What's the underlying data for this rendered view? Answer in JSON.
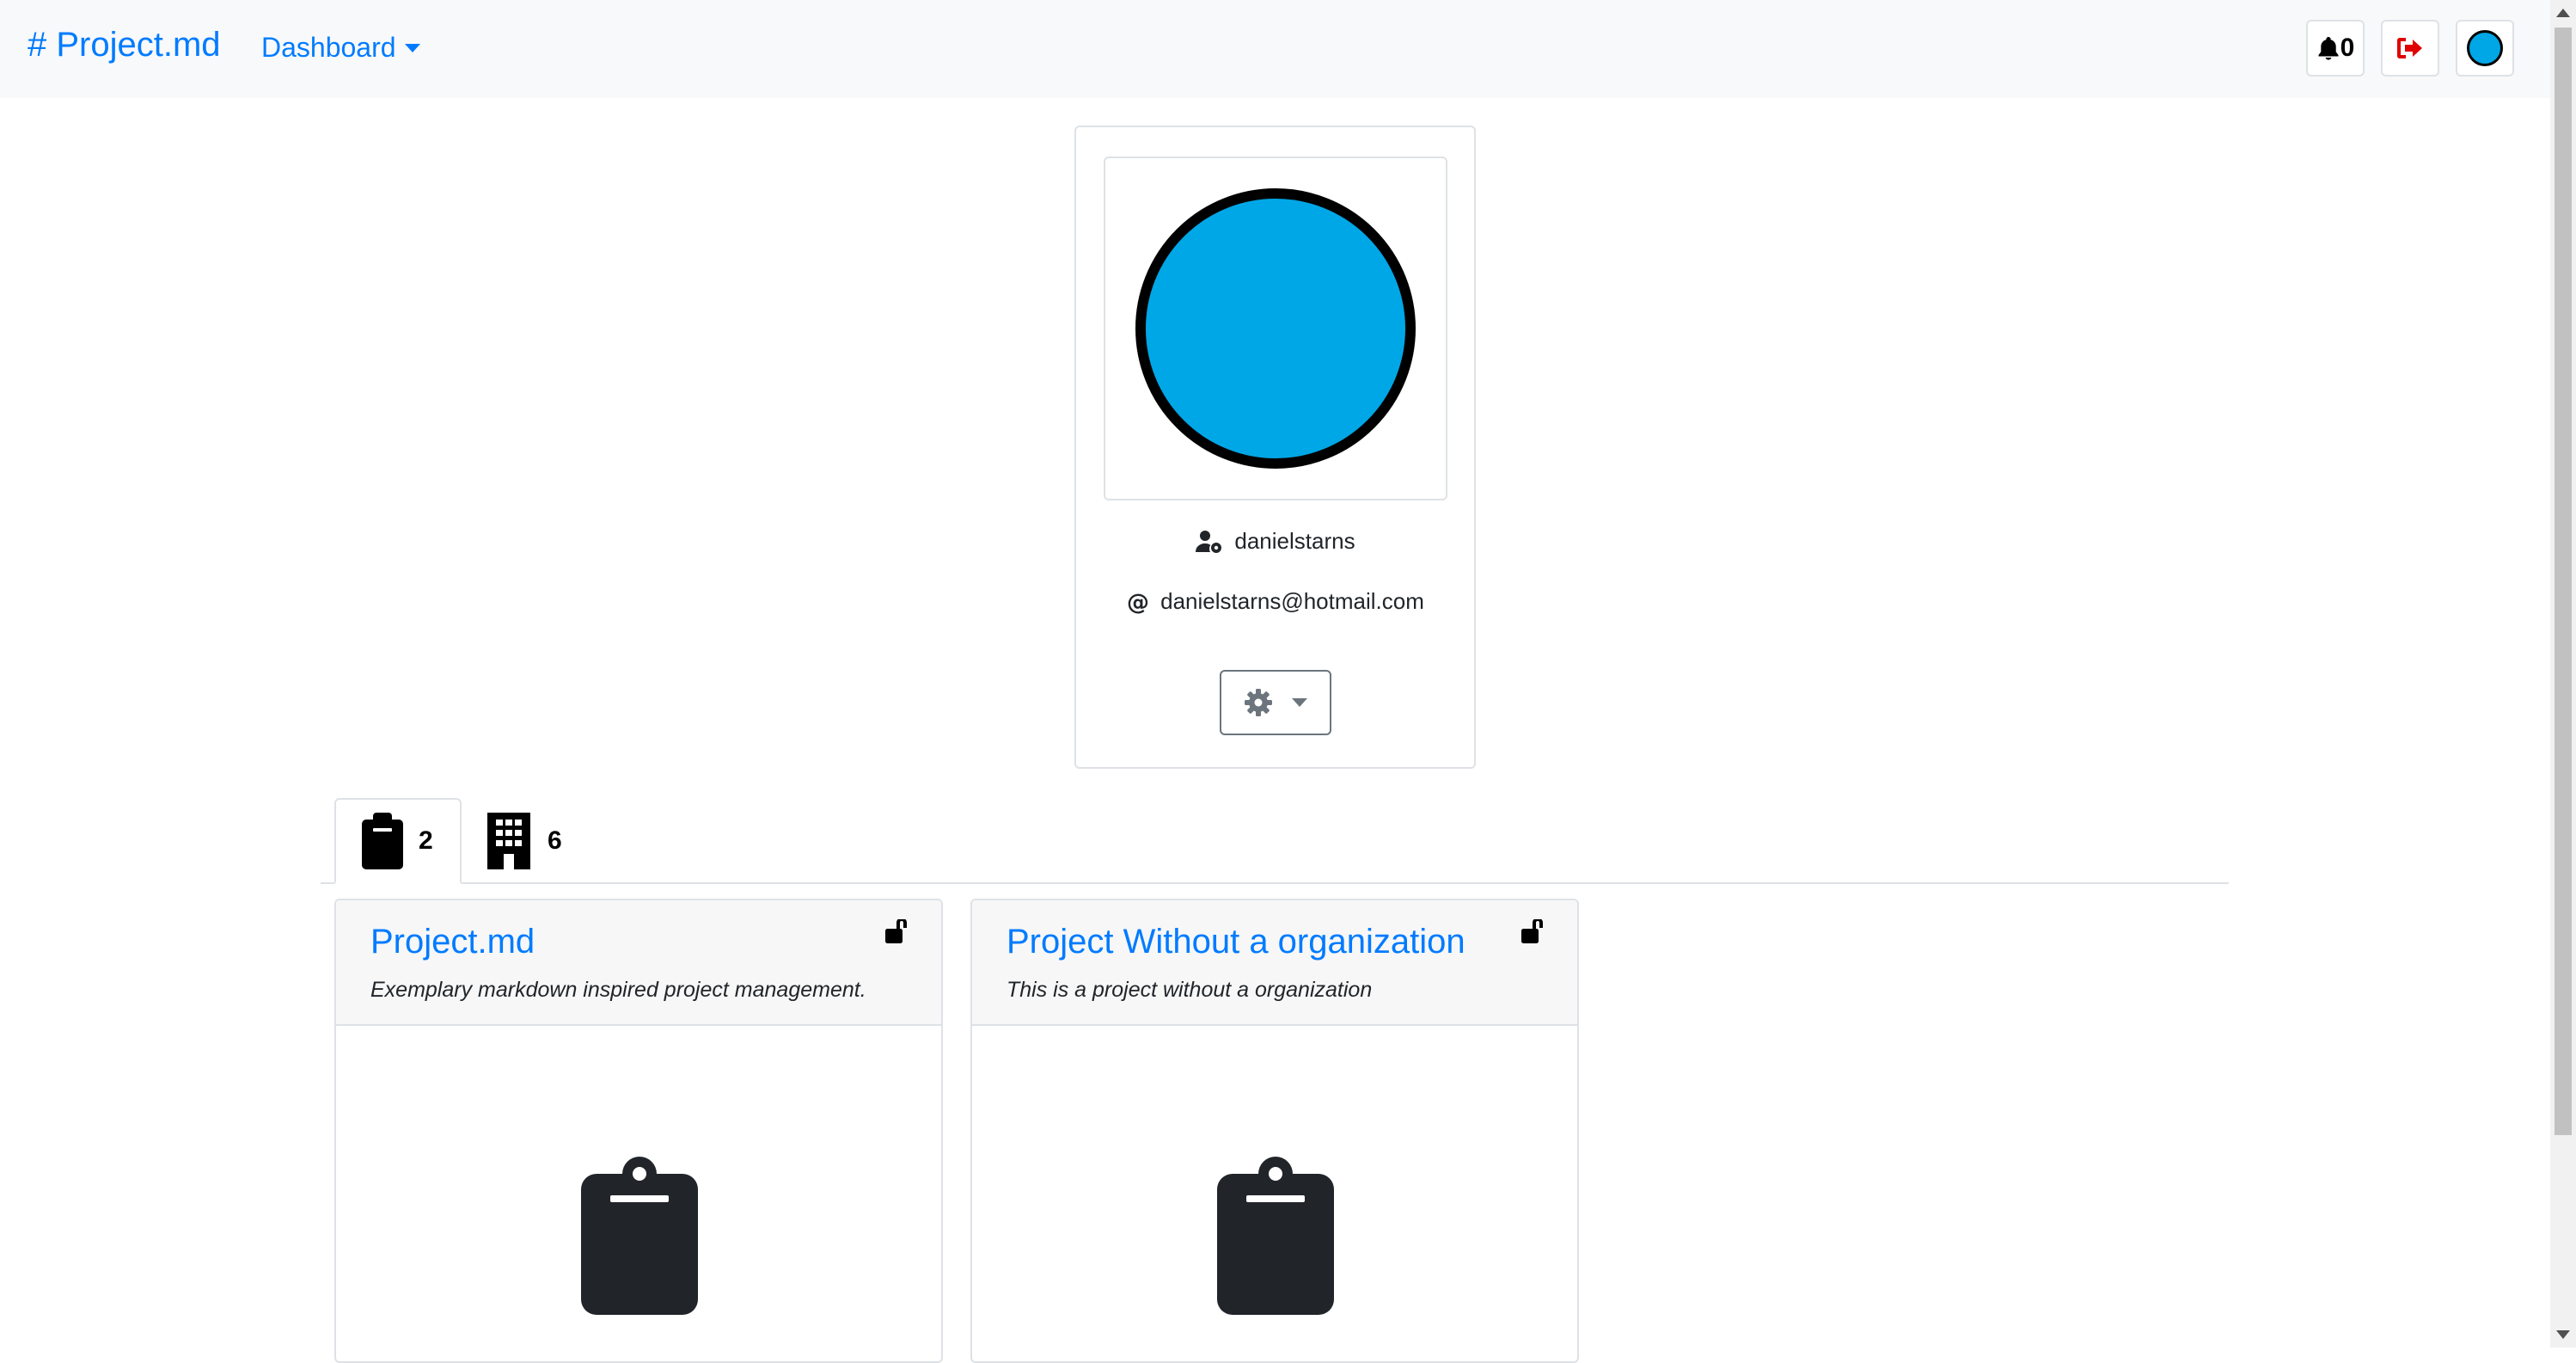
{
  "navbar": {
    "brand": "# Project.md",
    "dashboard_label": "Dashboard",
    "notification_count": "0"
  },
  "profile": {
    "username": "danielstarns",
    "email": "danielstarns@hotmail.com",
    "avatar_color": "#00a7e6"
  },
  "tabs": [
    {
      "icon": "clipboard-icon",
      "count": "2"
    },
    {
      "icon": "building-icon",
      "count": "6"
    }
  ],
  "projects": [
    {
      "title": "Project.md",
      "description": "Exemplary markdown inspired project management."
    },
    {
      "title": "Project Without a organization",
      "description": "This is a project without a organization"
    }
  ],
  "colors": {
    "accent": "#007bff",
    "logout": "#e00000",
    "icon_dark": "#212529"
  }
}
